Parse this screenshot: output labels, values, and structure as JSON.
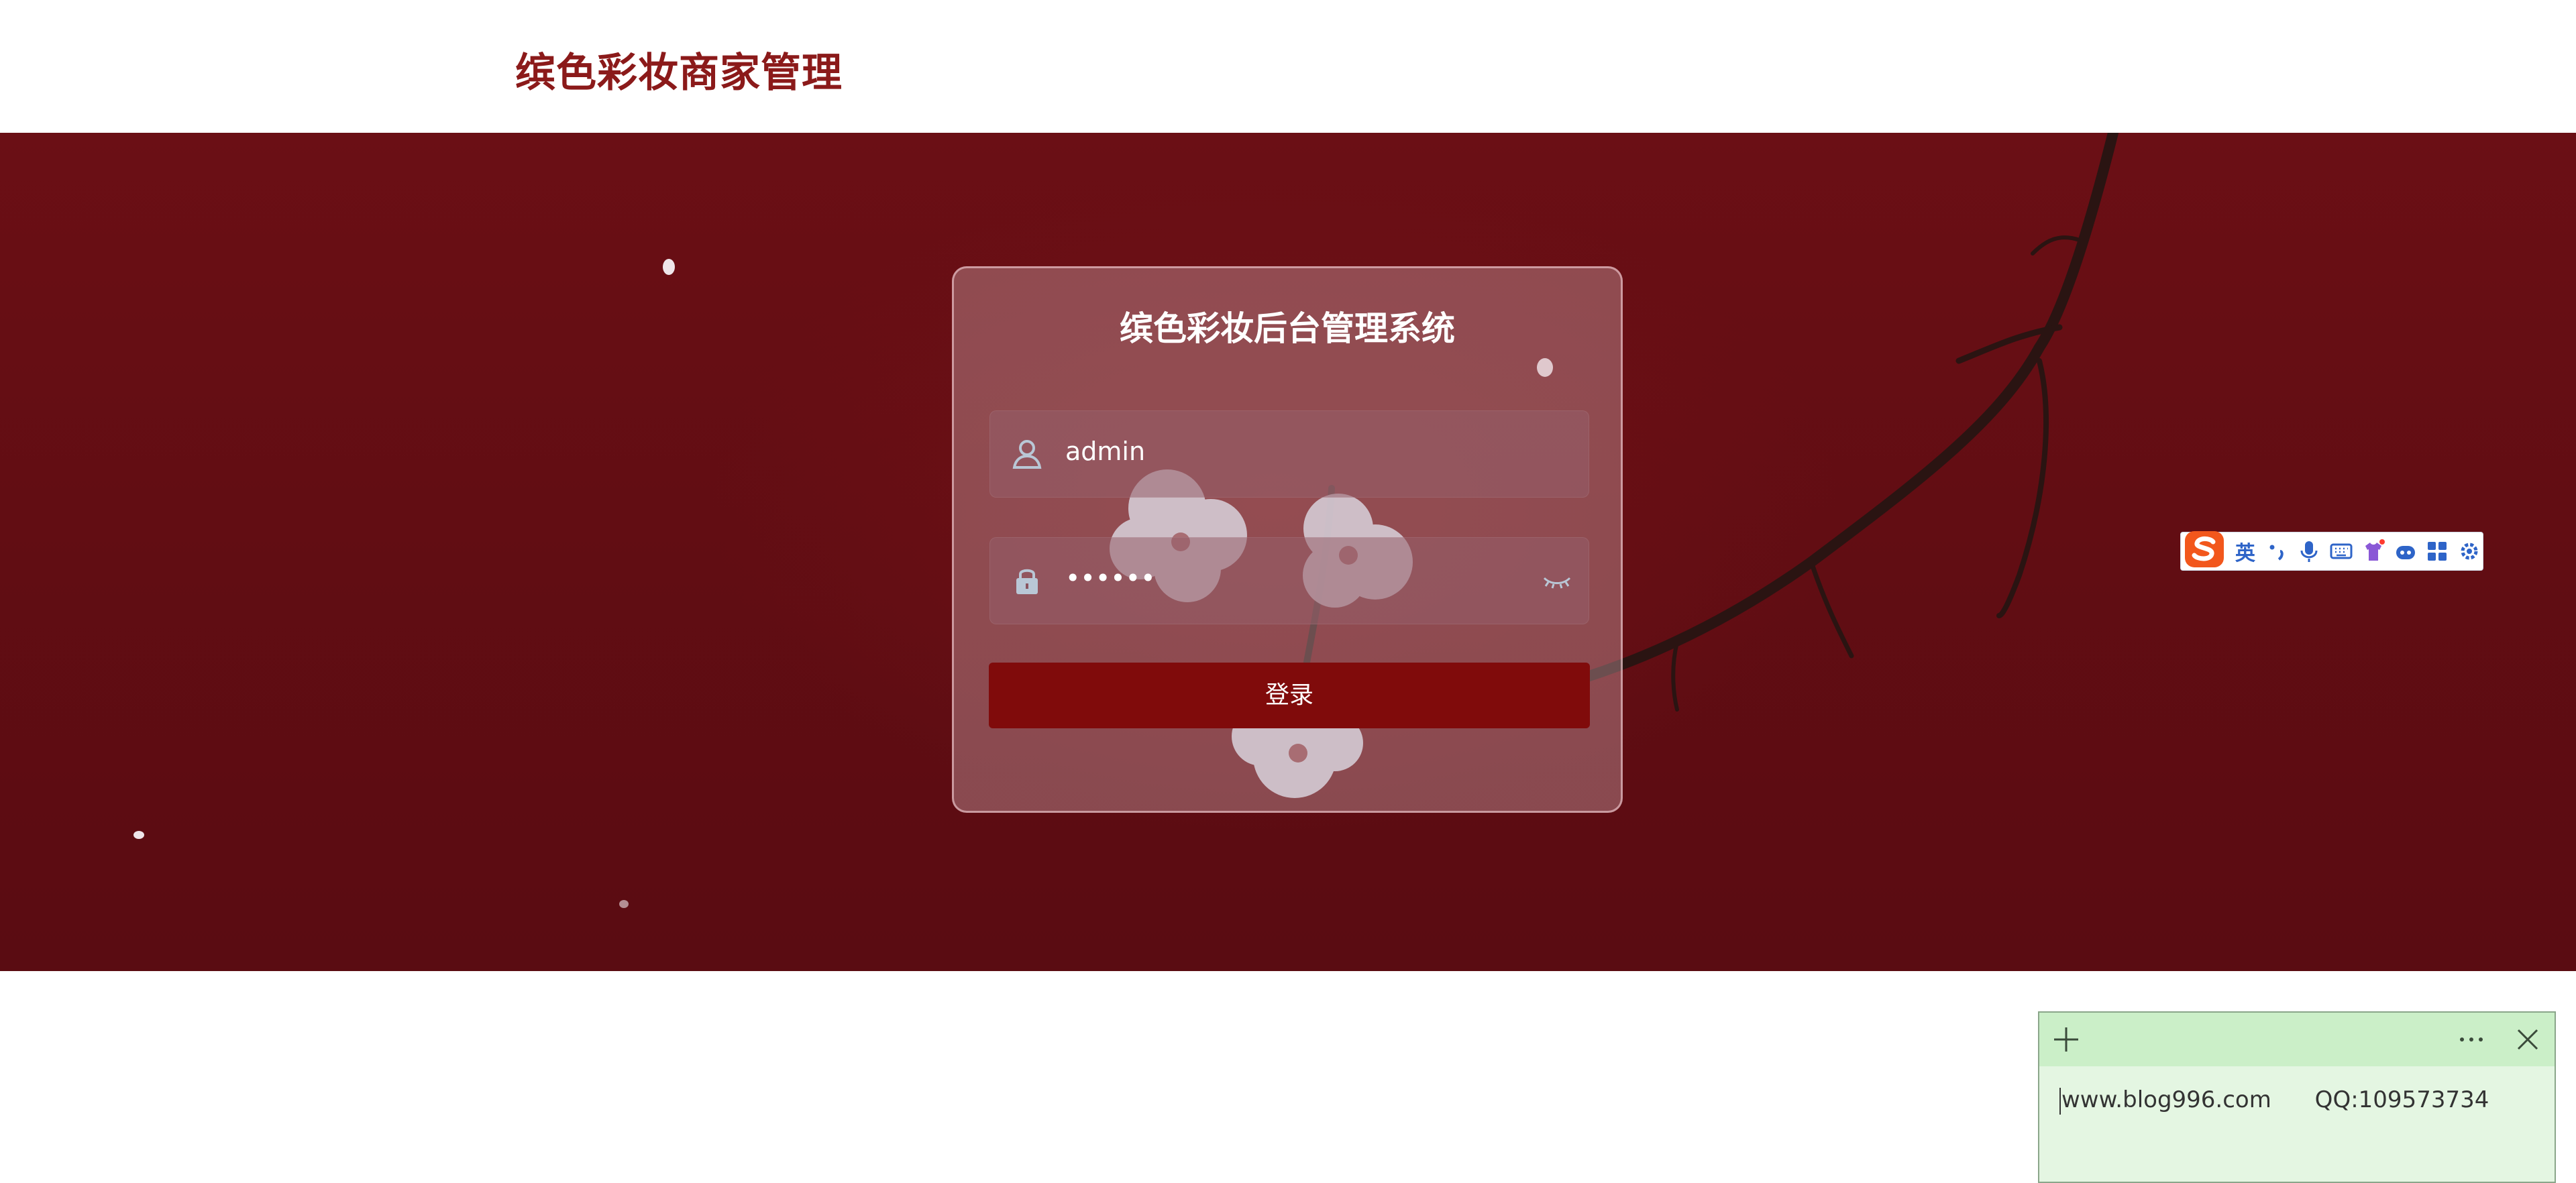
{
  "header": {
    "brand_title": "缤色彩妆商家管理"
  },
  "login": {
    "title": "缤色彩妆后台管理系统",
    "username_value": "admin",
    "password_value": "••••••",
    "submit_label": "登录"
  },
  "ime_toolbar": {
    "lang_label": "英",
    "items": [
      "punctuation-icon",
      "microphone-icon",
      "keyboard-icon",
      "skin-icon",
      "robot-icon",
      "apps-grid-icon",
      "settings-icon"
    ]
  },
  "sticky_note": {
    "text": "www.blog996.com      QQ:109573734"
  },
  "colors": {
    "brand": "#8b1a1a",
    "hero_bg": "#620d13",
    "button": "#800b0b",
    "sticky_bg": "#e4f6e2",
    "sticky_header": "#cbefc8"
  }
}
